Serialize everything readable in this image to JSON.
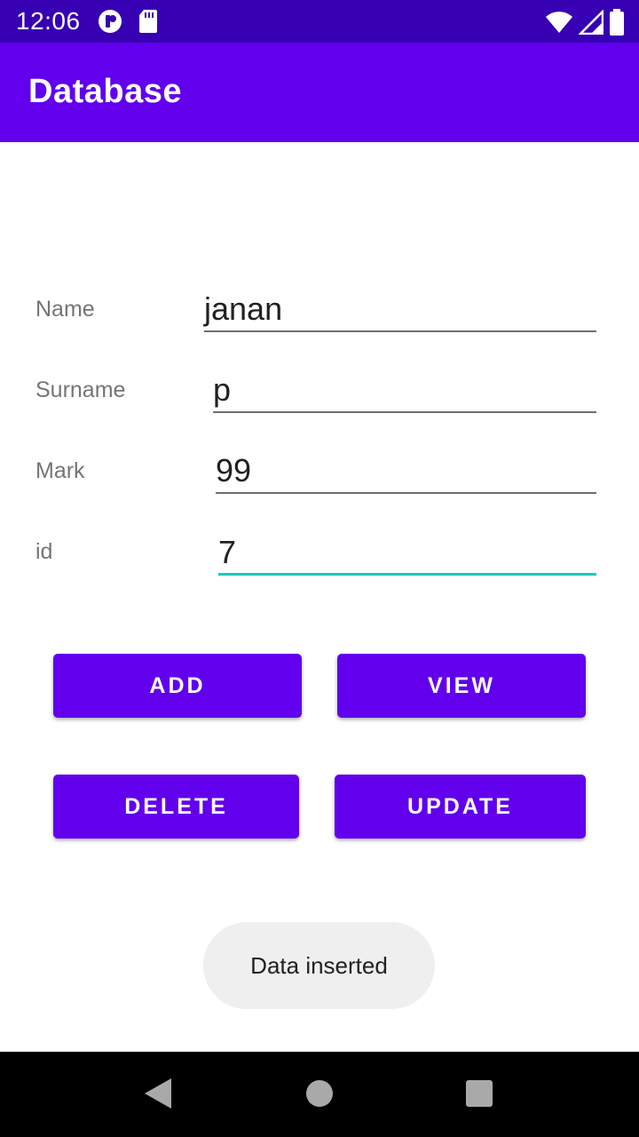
{
  "status_bar": {
    "time": "12:06",
    "left_icons": [
      "app-badge-icon",
      "sd-card-icon"
    ],
    "right_icons": [
      "wifi-icon",
      "cellular-signal-icon",
      "battery-icon"
    ]
  },
  "app_bar": {
    "title": "Database"
  },
  "form": {
    "name": {
      "label": "Name",
      "value": "janan"
    },
    "surname": {
      "label": "Surname",
      "value": "p"
    },
    "mark": {
      "label": "Mark",
      "value": "99"
    },
    "id": {
      "label": "id",
      "value": "7"
    }
  },
  "buttons": {
    "add": "ADD",
    "view": "VIEW",
    "delete": "DELETE",
    "update": "UPDATE"
  },
  "toast": {
    "message": "Data inserted"
  },
  "colors": {
    "primary": "#6200ee",
    "primary_dark": "#3700b3",
    "focus_underline": "#18c9c0"
  }
}
